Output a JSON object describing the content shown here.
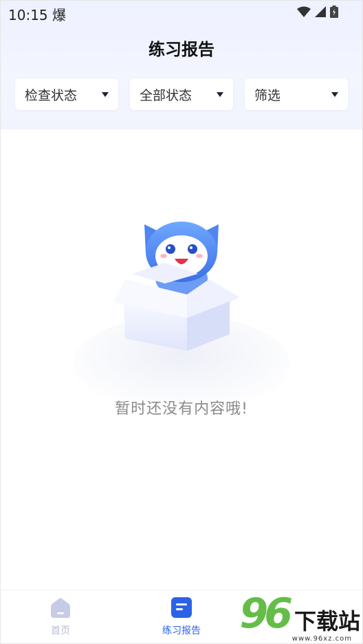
{
  "status_bar": {
    "time": "10:15",
    "app_glyph": "爆"
  },
  "header": {
    "title": "练习报告"
  },
  "filters": [
    {
      "label": "检查状态"
    },
    {
      "label": "全部状态"
    },
    {
      "label": "筛选"
    }
  ],
  "empty_state": {
    "message": "暂时还没有内容哦!",
    "illustration": "mascot-in-box"
  },
  "tabbar": {
    "items": [
      {
        "label": "首页",
        "icon": "home-icon",
        "active": false
      },
      {
        "label": "练习报告",
        "icon": "report-icon",
        "active": true
      }
    ]
  },
  "watermark": {
    "number": "96",
    "text": "下载站",
    "url": "www.96xz.com"
  },
  "colors": {
    "accent": "#2b63e8",
    "inactive": "#b8bdd0",
    "header_bg": "#eef1ff",
    "watermark_green": "#64bd48"
  }
}
